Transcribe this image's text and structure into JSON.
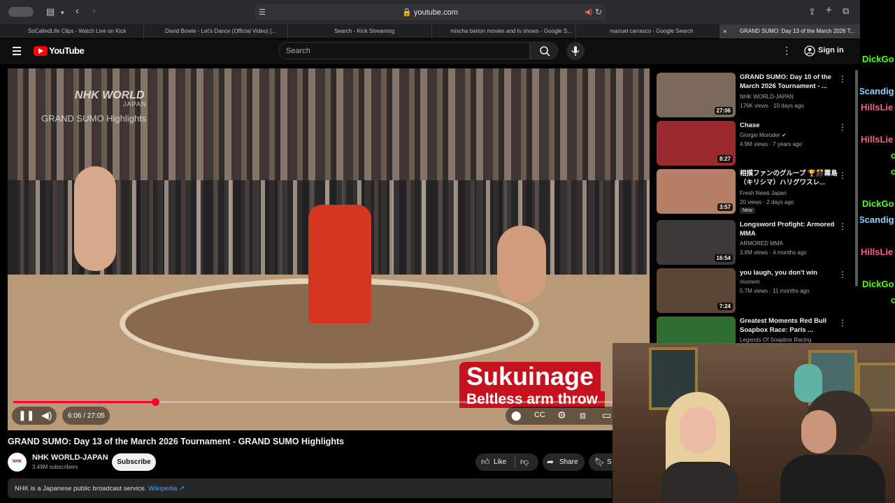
{
  "browser": {
    "url": "youtube.com",
    "tabs": [
      {
        "label": "SoCalledLife Clips - Watch Live on Kick",
        "favicon_color": "#53fc18"
      },
      {
        "label": "David Bowie - Let's Dance (Official Video) [...",
        "favicon_color": "#ff0000"
      },
      {
        "label": "Search - Kick Streaming",
        "favicon_color": "#53fc18"
      },
      {
        "label": "mischa barton movies and tv shows - Google S...",
        "favicon_color": "#9aa0a6"
      },
      {
        "label": "manuel carrasco - Google Search",
        "favicon_color": "#9aa0a6"
      },
      {
        "label": "GRAND SUMO: Day 13 of the March 2026 T...",
        "favicon_color": "#ff0000"
      }
    ]
  },
  "header": {
    "logo": "YouTube",
    "search_placeholder": "Search",
    "sign_in": "Sign in"
  },
  "player": {
    "overlay_brand": "NHK WORLD",
    "overlay_brand_sub": "JAPAN",
    "overlay_show": "GRAND SUMO Highlights",
    "caption_main": "Sukuinage",
    "caption_sub": "Beltless arm throw",
    "time": "6:06 / 27:05",
    "progress": 0.2254
  },
  "video": {
    "title": "GRAND SUMO: Day 13 of the March 2026 Tournament - GRAND SUMO Highlights",
    "channel": "NHK WORLD-JAPAN",
    "avatar_text": "NHK WORLD",
    "subscribers": "3.49M subscribers",
    "subscribe": "Subscribe",
    "like": "Like",
    "share": "Share",
    "save": "S",
    "info_text": "NHK is a Japanese public broadcast service.",
    "info_link": "Wikipedia ↗"
  },
  "related": [
    {
      "title": "GRAND SUMO: Day 10 of the March 2026 Tournament - ...",
      "channel": "NHK WORLD-JAPAN",
      "meta": "176K views · 10 days ago",
      "duration": "27:06",
      "thumb": "#7b6a5a"
    },
    {
      "title": "Chase",
      "channel": "Giorgio Moroder ✔",
      "meta": "4.9M views · 7 years ago",
      "duration": "8:27",
      "thumb": "#9b2a2e"
    },
    {
      "title": "相撲ファンのグループ 🏆🎊霧島（キリシマ）ハリグワスレ...",
      "channel": "Fresh News Japan",
      "meta": "20 views · 2 days ago",
      "duration": "3:57",
      "thumb": "#b77f66",
      "badge": "New"
    },
    {
      "title": "Longsword Profight: Armored MMA",
      "channel": "ARMORED MMA",
      "meta": "3.6M views · 4 months ago",
      "duration": "16:54",
      "thumb": "#3c3a36"
    },
    {
      "title": "you laugh, you don't win",
      "channel": "momem",
      "meta": "5.7M views · 11 months ago",
      "duration": "7:24",
      "thumb": "#5c4636"
    },
    {
      "title": "Greatest Moments Red Bull Soapbox Race: Paris ...",
      "channel": "Legends Of Soapbox Racing",
      "meta": "",
      "duration": "",
      "thumb": "#2f6e32"
    }
  ],
  "chat": [
    {
      "text": "DickGo",
      "color": "#53fc18"
    },
    {
      "text": "Scandig",
      "color": "#8fd3ff"
    },
    {
      "text": "HillsLie",
      "color": "#ff5f87"
    },
    {
      "text": "HillsLie",
      "color": "#ff5f87"
    },
    {
      "text": "c",
      "color": "#53fc18"
    },
    {
      "text": "c",
      "color": "#53fc18"
    },
    {
      "text": "DickGo",
      "color": "#53fc18"
    },
    {
      "text": "Scandig",
      "color": "#8fd3ff"
    },
    {
      "text": "HillsLie",
      "color": "#ff5f87"
    },
    {
      "text": "DickGo",
      "color": "#53fc18"
    },
    {
      "text": "c",
      "color": "#53fc18"
    }
  ]
}
